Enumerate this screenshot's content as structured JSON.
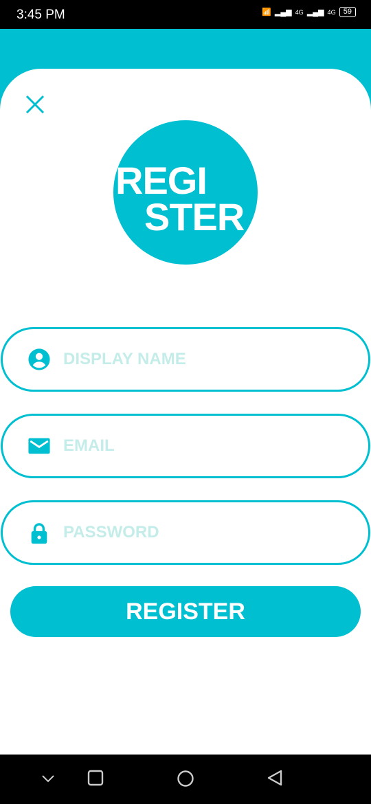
{
  "status_bar": {
    "time": "3:45 PM",
    "net1": "4G",
    "net2": "4G",
    "battery": "59"
  },
  "logo": {
    "line1": "REGI",
    "line2": "STER"
  },
  "form": {
    "display_name": {
      "placeholder": "DISPLAY NAME",
      "value": ""
    },
    "email": {
      "placeholder": "EMAIL",
      "value": ""
    },
    "password": {
      "placeholder": "PASSWORD",
      "value": ""
    },
    "submit_label": "REGISTER"
  },
  "colors": {
    "accent": "#00bfd1",
    "placeholder": "#c4ede9"
  }
}
